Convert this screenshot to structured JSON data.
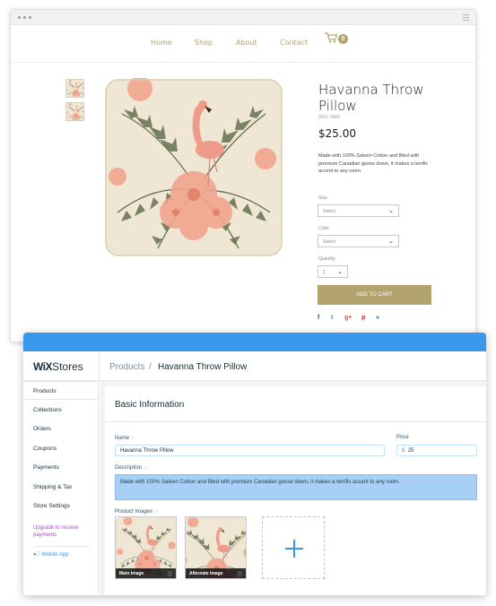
{
  "storefront": {
    "nav": [
      "Home",
      "Shop",
      "About",
      "Contact"
    ],
    "cart_count": "0",
    "product": {
      "title": "Havanna Throw Pillow",
      "sku": "SKU: 0002",
      "price": "$25.00",
      "description": "Made with 100% Sateen Cotton and filled with premium Canadian goose down, it makes a terrific accent to any room.",
      "size_label": "Size",
      "size_value": "Select",
      "color_label": "Color",
      "color_value": "Select",
      "quantity_label": "Quantity",
      "quantity_value": "1",
      "add_to_cart": "ADD TO CART"
    },
    "share_icons": [
      {
        "name": "facebook",
        "glyph": "f",
        "color": "#3b5998"
      },
      {
        "name": "twitter",
        "glyph": "t",
        "color": "#1da1f2"
      },
      {
        "name": "google-plus",
        "glyph": "g+",
        "color": "#dd4b39"
      },
      {
        "name": "pinterest",
        "glyph": "p",
        "color": "#cb2027"
      },
      {
        "name": "tumblr",
        "glyph": "●",
        "color": "#3899ec"
      }
    ],
    "accent_color": "#b3a36c"
  },
  "dashboard": {
    "logo_bold": "WiX",
    "logo_rest": "Stores",
    "breadcrumb_parent": "Products",
    "breadcrumb_sep": "/",
    "breadcrumb_current": "Havanna Throw Pillow",
    "sidebar": [
      "Products",
      "Collections",
      "Orders",
      "Coupons",
      "Payments",
      "Shipping & Tax",
      "Store Settings"
    ],
    "upgrade": "Upgrade to receive payments",
    "mobile_app": "Mobile App",
    "section_title": "Basic Information",
    "name_label": "Name",
    "name_value": "Havanna Throw Pillow",
    "price_label": "Price",
    "price_currency": "$",
    "price_value": "25",
    "description_label": "Description",
    "description_value": "Made with 100% Sateen Cotton and filled with premium Canadian goose down, it makes a terrific accent to any room.",
    "images_label": "Product Images",
    "main_image_caption": "Main Image",
    "alt_image_caption": "Alternate Image",
    "accent_color": "#3899ec"
  }
}
